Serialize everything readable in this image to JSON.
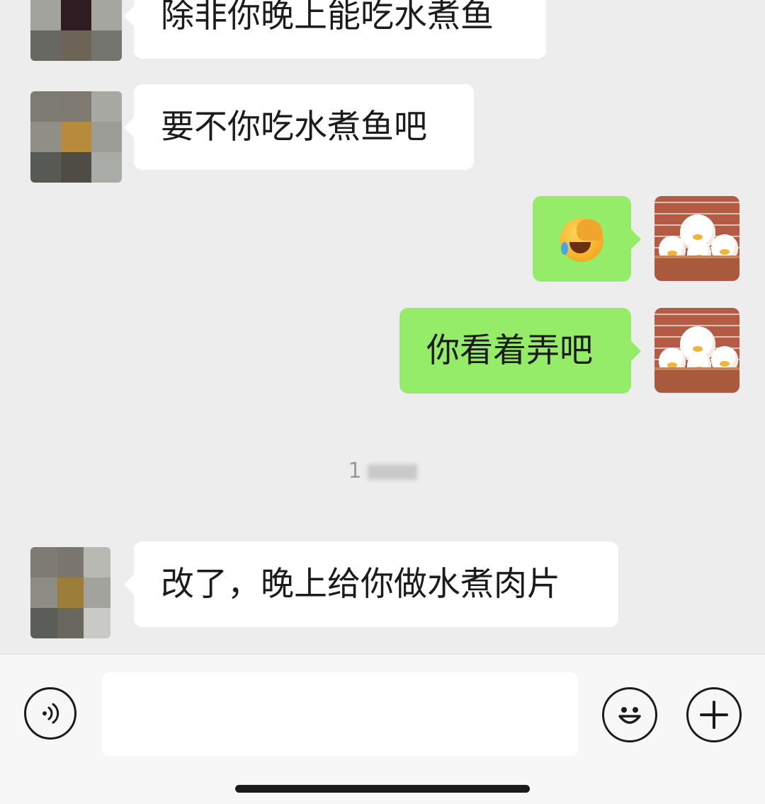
{
  "messages": [
    {
      "side": "in",
      "text": "除非你晚上能吃水煮鱼"
    },
    {
      "side": "in",
      "text": "要不你吃水煮鱼吧"
    },
    {
      "side": "out",
      "emoji": "face-with-hand-over-eyes-crying"
    },
    {
      "side": "out",
      "text": "你看着弄吧"
    },
    {
      "side": "in",
      "text": "改了，晚上给你做水煮肉片"
    }
  ],
  "timestamp": {
    "visible_text": "1"
  },
  "input_bar": {
    "voice_icon": "voice-icon",
    "emoji_icon": "smiley-icon",
    "plus_icon": "plus-icon",
    "input_value": ""
  },
  "colors": {
    "background": "#ededed",
    "incoming_bubble": "#ffffff",
    "outgoing_bubble": "#95ec69"
  }
}
